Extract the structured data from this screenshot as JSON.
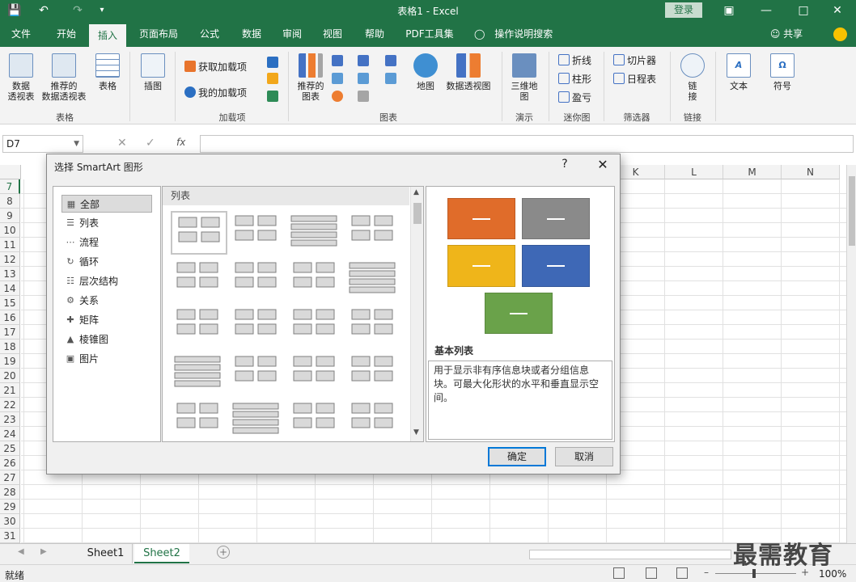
{
  "window": {
    "title": "表格1 - Excel",
    "login_label": "登录"
  },
  "menu": {
    "tabs": [
      "文件",
      "开始",
      "插入",
      "页面布局",
      "公式",
      "数据",
      "审阅",
      "视图",
      "帮助",
      "PDF工具集",
      "操作说明搜索"
    ],
    "share_label": "共享"
  },
  "ribbon": {
    "tables": {
      "pivot": "数据\n透视表",
      "recommended_pivot": "推荐的\n数据透视表",
      "table": "表格",
      "group": "表格"
    },
    "illustrations": {
      "label": "插图"
    },
    "addins": {
      "get": "获取加载项",
      "mine": "我的加载项",
      "group": "加载项"
    },
    "charts": {
      "recommended": "推荐的\n图表",
      "map": "地图",
      "pivotchart": "数据透视图",
      "group": "图表"
    },
    "tours": {
      "map3d": "三维地\n图",
      "group": "演示"
    },
    "sparklines": {
      "line": "折线",
      "column": "柱形",
      "winloss": "盈亏",
      "group": "迷你图"
    },
    "filters": {
      "slicer": "切片器",
      "timeline": "日程表",
      "group": "筛选器"
    },
    "links": {
      "link": "链\n接",
      "group": "链接"
    },
    "text": {
      "label": "文本"
    },
    "symbols": {
      "label": "符号"
    }
  },
  "formula_bar": {
    "name_box": "D7",
    "fx": "fx"
  },
  "grid": {
    "columns_right": [
      "K",
      "L",
      "M",
      "N"
    ],
    "rows": [
      "7",
      "8",
      "9",
      "10",
      "11",
      "12",
      "13",
      "14",
      "15",
      "16",
      "17",
      "18",
      "19",
      "20",
      "21",
      "22",
      "23",
      "24",
      "25",
      "26",
      "27",
      "28",
      "29",
      "30",
      "31"
    ]
  },
  "sheets": [
    "Sheet1",
    "Sheet2"
  ],
  "status": {
    "ready": "就绪",
    "zoom": "100%"
  },
  "dialog": {
    "title": "选择 SmartArt 图形",
    "help": "?",
    "categories": [
      {
        "label": "全部",
        "icon": "all-icon"
      },
      {
        "label": "列表",
        "icon": "list-icon"
      },
      {
        "label": "流程",
        "icon": "process-icon"
      },
      {
        "label": "循环",
        "icon": "cycle-icon"
      },
      {
        "label": "层次结构",
        "icon": "hierarchy-icon"
      },
      {
        "label": "关系",
        "icon": "relationship-icon"
      },
      {
        "label": "矩阵",
        "icon": "matrix-icon"
      },
      {
        "label": "棱锥图",
        "icon": "pyramid-icon"
      },
      {
        "label": "图片",
        "icon": "picture-icon"
      }
    ],
    "gallery_header": "列表",
    "preview": {
      "name": "基本列表",
      "description": "用于显示非有序信息块或者分组信息块。可最大化形状的水平和垂直显示空间。",
      "colors": [
        "#e06c2a",
        "#8a8a8a",
        "#efb51a",
        "#3e68b6",
        "#6aa24a"
      ]
    },
    "ok_label": "确定",
    "cancel_label": "取消"
  },
  "watermark": "最需教育"
}
